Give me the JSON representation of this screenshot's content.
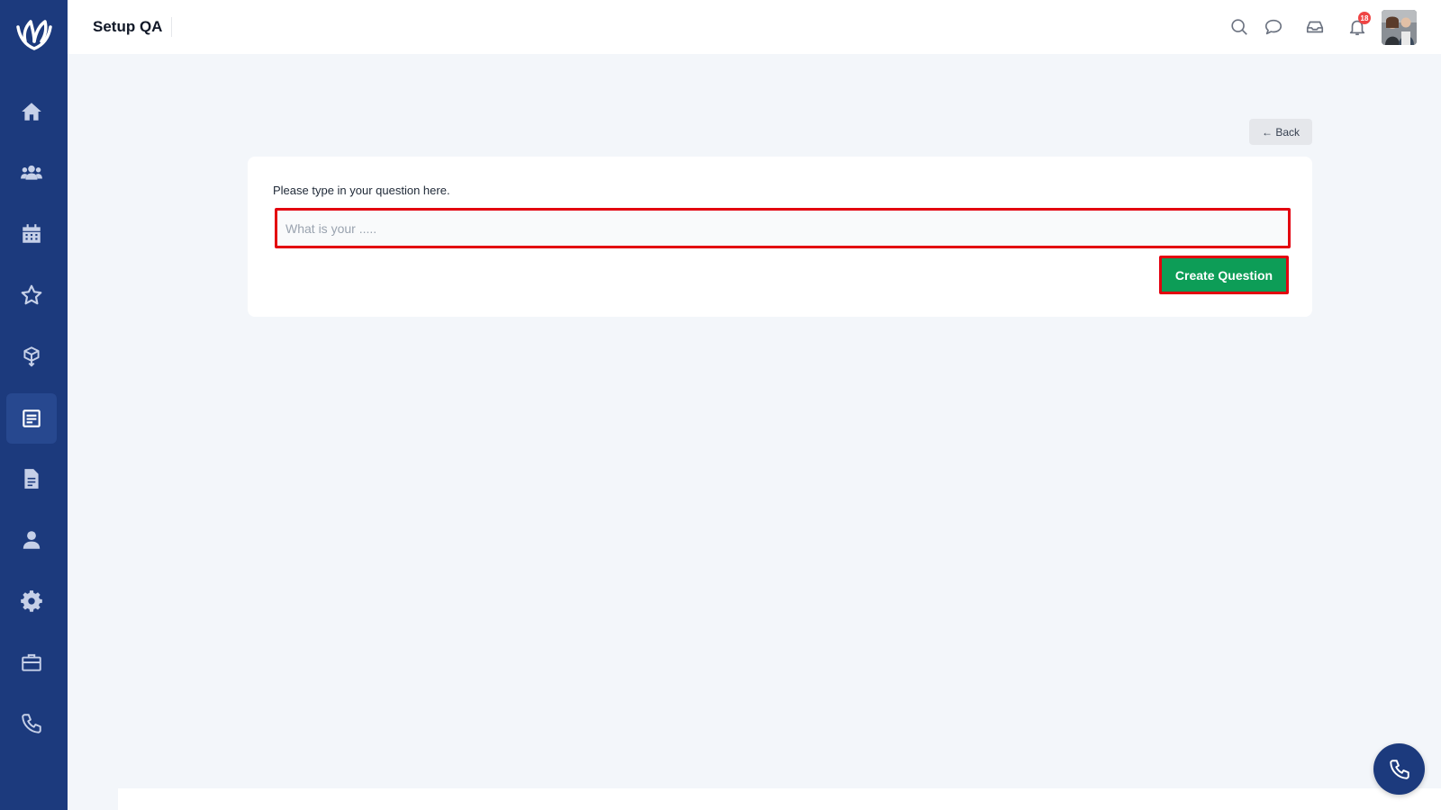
{
  "header": {
    "title": "Setup QA",
    "notification_count": "18"
  },
  "sidebar": {
    "items": [
      {
        "icon": "home-icon"
      },
      {
        "icon": "users-icon"
      },
      {
        "icon": "calendar-icon"
      },
      {
        "icon": "star-icon"
      },
      {
        "icon": "box-icon"
      },
      {
        "icon": "checklist-icon",
        "active": true
      },
      {
        "icon": "document-icon"
      },
      {
        "icon": "user-icon"
      },
      {
        "icon": "gear-icon"
      },
      {
        "icon": "briefcase-icon"
      },
      {
        "icon": "phone-icon"
      }
    ]
  },
  "main": {
    "back_label": "← Back",
    "question_label": "Please type in your question here.",
    "question_input": {
      "value": "",
      "placeholder": "What is your ....."
    },
    "create_label": "Create Question"
  },
  "colors": {
    "sidebar": "#1c3a7d",
    "primary_button": "#0d9d57",
    "highlight_border": "#e3000f"
  }
}
